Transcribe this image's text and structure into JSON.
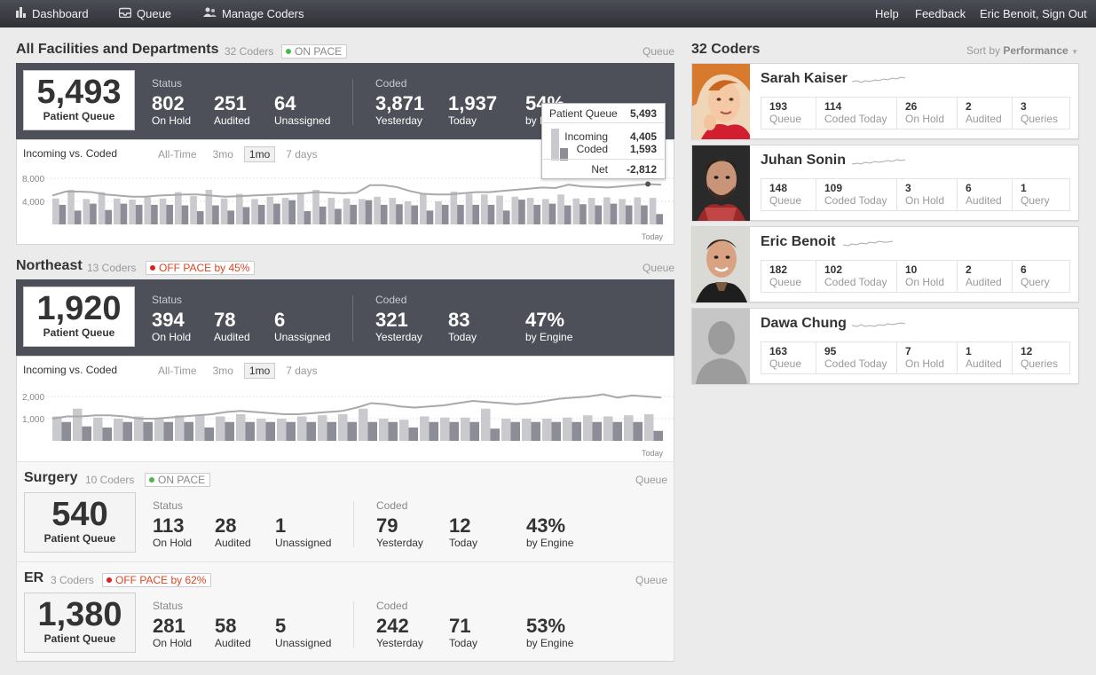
{
  "topbar": {
    "dashboard": "Dashboard",
    "queue": "Queue",
    "manage_coders": "Manage Coders",
    "help": "Help",
    "feedback": "Feedback",
    "user": "Eric Benoit, Sign Out"
  },
  "colors": {
    "topbar": "#3a3d43",
    "dark_panel": "#4d5058",
    "on_pace": "#4bb84b",
    "off_pace": "#e02020"
  },
  "sections": {
    "all": {
      "title": "All Facilities and Departments",
      "count": "32 Coders",
      "badge": "ON PACE",
      "queue_link": "Queue",
      "patient_queue": "5,493",
      "patient_queue_label": "Patient Queue",
      "status_label": "Status",
      "coded_label": "Coded",
      "on_hold": "802",
      "on_hold_label": "On Hold",
      "audited": "251",
      "audited_label": "Audited",
      "unassigned": "64",
      "unassigned_label": "Unassigned",
      "yesterday": "3,871",
      "yesterday_label": "Yesterday",
      "today": "1,937",
      "today_label": "Today",
      "engine": "54%",
      "engine_label": "by Engine"
    },
    "northeast": {
      "title": "Northeast",
      "count": "13 Coders",
      "badge": "OFF PACE by 45%",
      "queue_link": "Queue",
      "patient_queue": "1,920",
      "patient_queue_label": "Patient Queue",
      "status_label": "Status",
      "coded_label": "Coded",
      "on_hold": "394",
      "on_hold_label": "On Hold",
      "audited": "78",
      "audited_label": "Audited",
      "unassigned": "6",
      "unassigned_label": "Unassigned",
      "yesterday": "321",
      "yesterday_label": "Yesterday",
      "today": "83",
      "today_label": "Today",
      "engine": "47%",
      "engine_label": "by Engine"
    },
    "surgery": {
      "title": "Surgery",
      "count": "10 Coders",
      "badge": "ON PACE",
      "queue_link": "Queue",
      "patient_queue": "540",
      "patient_queue_label": "Patient Queue",
      "status_label": "Status",
      "coded_label": "Coded",
      "on_hold": "113",
      "on_hold_label": "On Hold",
      "audited": "28",
      "audited_label": "Audited",
      "unassigned": "1",
      "unassigned_label": "Unassigned",
      "yesterday": "79",
      "yesterday_label": "Yesterday",
      "today": "12",
      "today_label": "Today",
      "engine": "43%",
      "engine_label": "by Engine"
    },
    "er": {
      "title": "ER",
      "count": "3 Coders",
      "badge": "OFF PACE by 62%",
      "queue_link": "Queue",
      "patient_queue": "1,380",
      "patient_queue_label": "Patient Queue",
      "status_label": "Status",
      "coded_label": "Coded",
      "on_hold": "281",
      "on_hold_label": "On Hold",
      "audited": "58",
      "audited_label": "Audited",
      "unassigned": "5",
      "unassigned_label": "Unassigned",
      "yesterday": "242",
      "yesterday_label": "Yesterday",
      "today": "71",
      "today_label": "Today",
      "engine": "53%",
      "engine_label": "by Engine"
    }
  },
  "chart_tabs": [
    "All-Time",
    "3mo",
    "1mo",
    "7 days"
  ],
  "chart_tabs_active": "1mo",
  "tooltip": {
    "patient_queue_label": "Patient Queue",
    "patient_queue": "5,493",
    "incoming_label": "Incoming",
    "incoming": "4,405",
    "coded_label": "Coded",
    "coded": "1,593",
    "net_label": "Net",
    "net": "-2,812"
  },
  "chart_data": [
    {
      "type": "bar",
      "title": "Incoming vs. Coded",
      "x_end_label": "Today",
      "yticks": [
        "8,000",
        "4,000"
      ],
      "ylim": [
        0,
        10000
      ],
      "series": [
        {
          "name": "Incoming",
          "values": [
            4500,
            6000,
            4400,
            5600,
            4500,
            4300,
            4700,
            4500,
            5600,
            4900,
            6000,
            4500,
            5300,
            4400,
            4800,
            4600,
            5500,
            6000,
            4600,
            4500,
            4400,
            4800,
            4600,
            4000,
            5300,
            4000,
            5700,
            5300,
            5200,
            5000,
            4800,
            4600,
            4400,
            5200,
            4500,
            4600,
            4700,
            4400,
            4700,
            4600
          ]
        },
        {
          "name": "Coded",
          "values": [
            3400,
            2400,
            3600,
            2500,
            3600,
            3400,
            3400,
            3400,
            3300,
            2300,
            3300,
            2400,
            3000,
            3400,
            3600,
            4200,
            2300,
            3100,
            2700,
            3400,
            4200,
            3400,
            3500,
            3300,
            2400,
            3400,
            3400,
            3400,
            3400,
            2400,
            4300,
            3400,
            3600,
            3300,
            3500,
            3300,
            3600,
            3300,
            3300,
            1800
          ]
        },
        {
          "name": "Patient Queue",
          "values": [
            5000,
            5700,
            5700,
            5600,
            5200,
            5000,
            4800,
            4800,
            5000,
            5100,
            5200,
            5200,
            5000,
            4800,
            4900,
            5000,
            5100,
            5200,
            5300,
            5400,
            5600,
            5500,
            5400,
            5500,
            6800,
            6800,
            6500,
            5800,
            5300,
            5200,
            5200,
            5400,
            5600,
            5600,
            5800,
            6000,
            6200,
            6400,
            6300,
            6900,
            6600,
            6500,
            6400,
            6600,
            6800,
            7000,
            6900
          ]
        }
      ]
    },
    {
      "type": "bar",
      "title": "Incoming vs. Coded",
      "x_end_label": "Today",
      "yticks": [
        "2,000",
        "1,000"
      ],
      "ylim": [
        0,
        2600
      ],
      "series": [
        {
          "name": "Incoming",
          "values": [
            1100,
            1450,
            1050,
            1000,
            1100,
            1000,
            1150,
            1150,
            1100,
            1200,
            1000,
            1000,
            1100,
            1150,
            1200,
            1450,
            1000,
            950,
            1100,
            1050,
            1050,
            1450,
            1000,
            1000,
            1000,
            1050,
            1150,
            1100,
            1150,
            1200
          ]
        },
        {
          "name": "Coded",
          "values": [
            850,
            650,
            600,
            850,
            850,
            850,
            850,
            600,
            850,
            850,
            850,
            850,
            850,
            850,
            850,
            850,
            850,
            600,
            850,
            850,
            850,
            550,
            850,
            850,
            850,
            850,
            850,
            850,
            850,
            450
          ]
        },
        {
          "name": "Patient Queue",
          "values": [
            1000,
            1100,
            1100,
            1150,
            1150,
            1100,
            1000,
            1000,
            1050,
            1100,
            1150,
            1200,
            1300,
            1350,
            1300,
            1250,
            1200,
            1200,
            1250,
            1300,
            1350,
            1500,
            1700,
            1650,
            1550,
            1500,
            1550,
            1600,
            1700,
            1800,
            1750,
            1700,
            1650,
            1700,
            1800,
            1900,
            1950,
            2000,
            2100,
            1950,
            2050,
            2000,
            1950
          ]
        }
      ]
    }
  ],
  "coders": {
    "title": "32 Coders",
    "sort_label": "Sort by",
    "sort_value": "Performance",
    "list": [
      {
        "name": "Sarah Kaiser",
        "queue": "193",
        "coded_today": "114",
        "on_hold": "26",
        "audited": "2",
        "queries": "3",
        "labels": [
          "Queue",
          "Coded Today",
          "On Hold",
          "Audited",
          "Queries"
        ]
      },
      {
        "name": "Juhan Sonin",
        "queue": "148",
        "coded_today": "109",
        "on_hold": "3",
        "audited": "6",
        "queries": "1",
        "labels": [
          "Queue",
          "Coded Today",
          "On Hold",
          "Audited",
          "Query"
        ]
      },
      {
        "name": "Eric Benoit",
        "queue": "182",
        "coded_today": "102",
        "on_hold": "10",
        "audited": "2",
        "queries": "6",
        "labels": [
          "Queue",
          "Coded Today",
          "On Hold",
          "Audited",
          "Query"
        ]
      },
      {
        "name": "Dawa Chung",
        "queue": "163",
        "coded_today": "95",
        "on_hold": "7",
        "audited": "1",
        "queries": "12",
        "labels": [
          "Queue",
          "Coded Today",
          "On Hold",
          "Audited",
          "Queries"
        ]
      }
    ]
  }
}
